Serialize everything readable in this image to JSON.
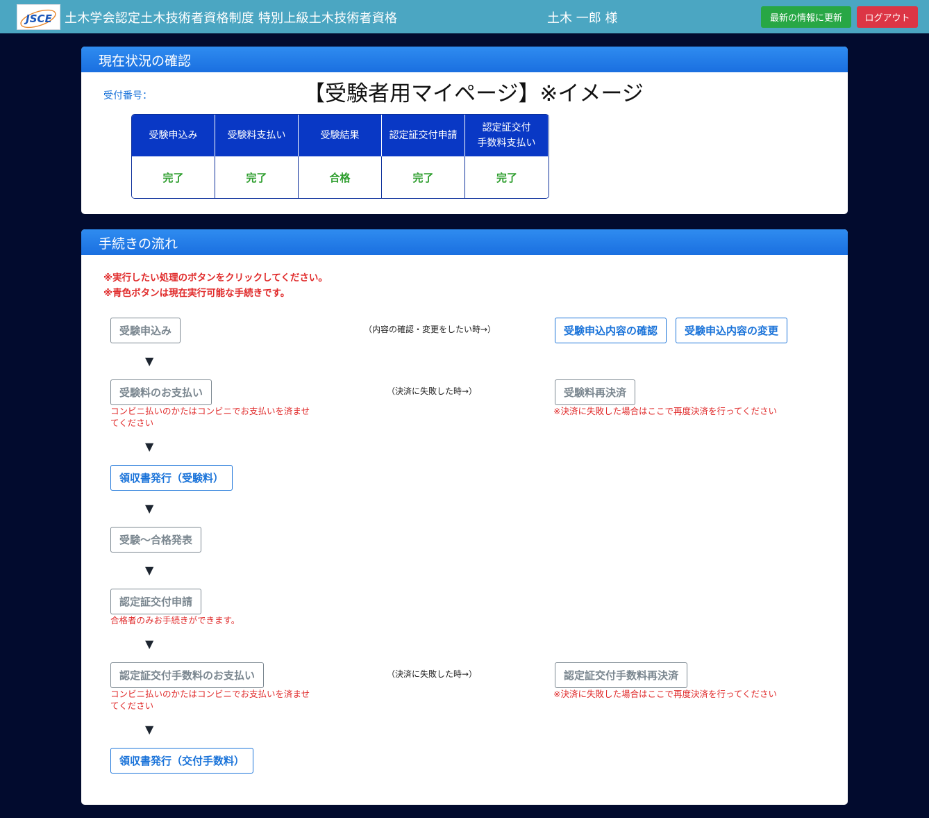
{
  "header": {
    "logo_text": "JSCE",
    "title": "土木学会認定土木技術者資格制度 特別上級土木技術者資格",
    "user": "土木 一郎 様",
    "refresh_label": "最新の情報に更新",
    "logout_label": "ログアウト",
    "colors": {
      "bar": "#4ba6c2",
      "refresh": "#28a745",
      "logout": "#dc3545"
    }
  },
  "status_card": {
    "title": "現在状況の確認",
    "receipt_label": "受付番号：",
    "page_title": "【受験者用マイページ】※イメージ",
    "columns": [
      {
        "head": "受験申込み",
        "value": "完了"
      },
      {
        "head": "受験料支払い",
        "value": "完了"
      },
      {
        "head": "受験結果",
        "value": "合格"
      },
      {
        "head": "認定証交付申請",
        "value": "完了"
      },
      {
        "head": "認定証交付\n手数料支払い",
        "value": "完了"
      }
    ]
  },
  "flow_card": {
    "title": "手続きの流れ",
    "notes": [
      "※実行したい処理のボタンをクリックしてください。",
      "※青色ボタンは現在実行可能な手続きです。"
    ],
    "arrow": "▼",
    "steps": {
      "apply": "受験申込み",
      "apply_hint": "（内容の確認・変更をしたい時→）",
      "apply_confirm": "受験申込内容の確認",
      "apply_change": "受験申込内容の変更",
      "pay": "受験料のお支払い",
      "pay_note": "コンビニ払いのかたはコンビニでお支払いを済ませてください",
      "pay_hint": "（決済に失敗した時→）",
      "pay_retry": "受験料再決済",
      "pay_retry_note": "※決済に失敗した場合はここで再度決済を行ってください",
      "receipt_exam": "領収書発行（受験料）",
      "exam": "受験〜合格発表",
      "cert_apply": "認定証交付申請",
      "cert_apply_note": "合格者のみお手続きができます。",
      "cert_pay": "認定証交付手数料のお支払い",
      "cert_pay_note": "コンビニ払いのかたはコンビニでお支払いを済ませてください",
      "cert_pay_hint": "（決済に失敗した時→）",
      "cert_pay_retry": "認定証交付手数料再決済",
      "cert_pay_retry_note": "※決済に失敗した場合はここで再度決済を行ってください",
      "receipt_cert": "領収書発行（交付手数料）"
    }
  }
}
